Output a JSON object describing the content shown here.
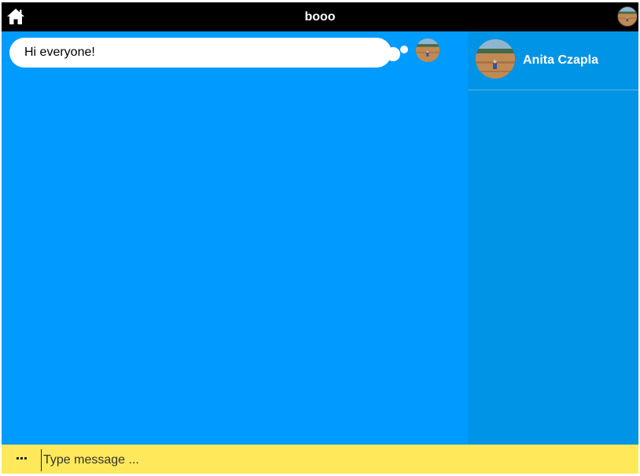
{
  "header": {
    "title": "booo",
    "home_icon": "home-icon",
    "profile_avatar": "user-avatar-icon"
  },
  "chat": {
    "messages": [
      {
        "text": "Hi everyone!",
        "avatar": "user-avatar-icon"
      }
    ]
  },
  "sidebar": {
    "users": [
      {
        "name": "Anita Czapla",
        "avatar": "user-avatar-icon"
      }
    ]
  },
  "composer": {
    "placeholder": "Type message ...",
    "value": "",
    "more_icon": "more-icon"
  },
  "colors": {
    "header_bg": "#000000",
    "chat_bg": "#009bff",
    "sidebar_bg": "#0094e6",
    "composer_bg": "#ffe95a",
    "bubble_bg": "#ffffff"
  }
}
